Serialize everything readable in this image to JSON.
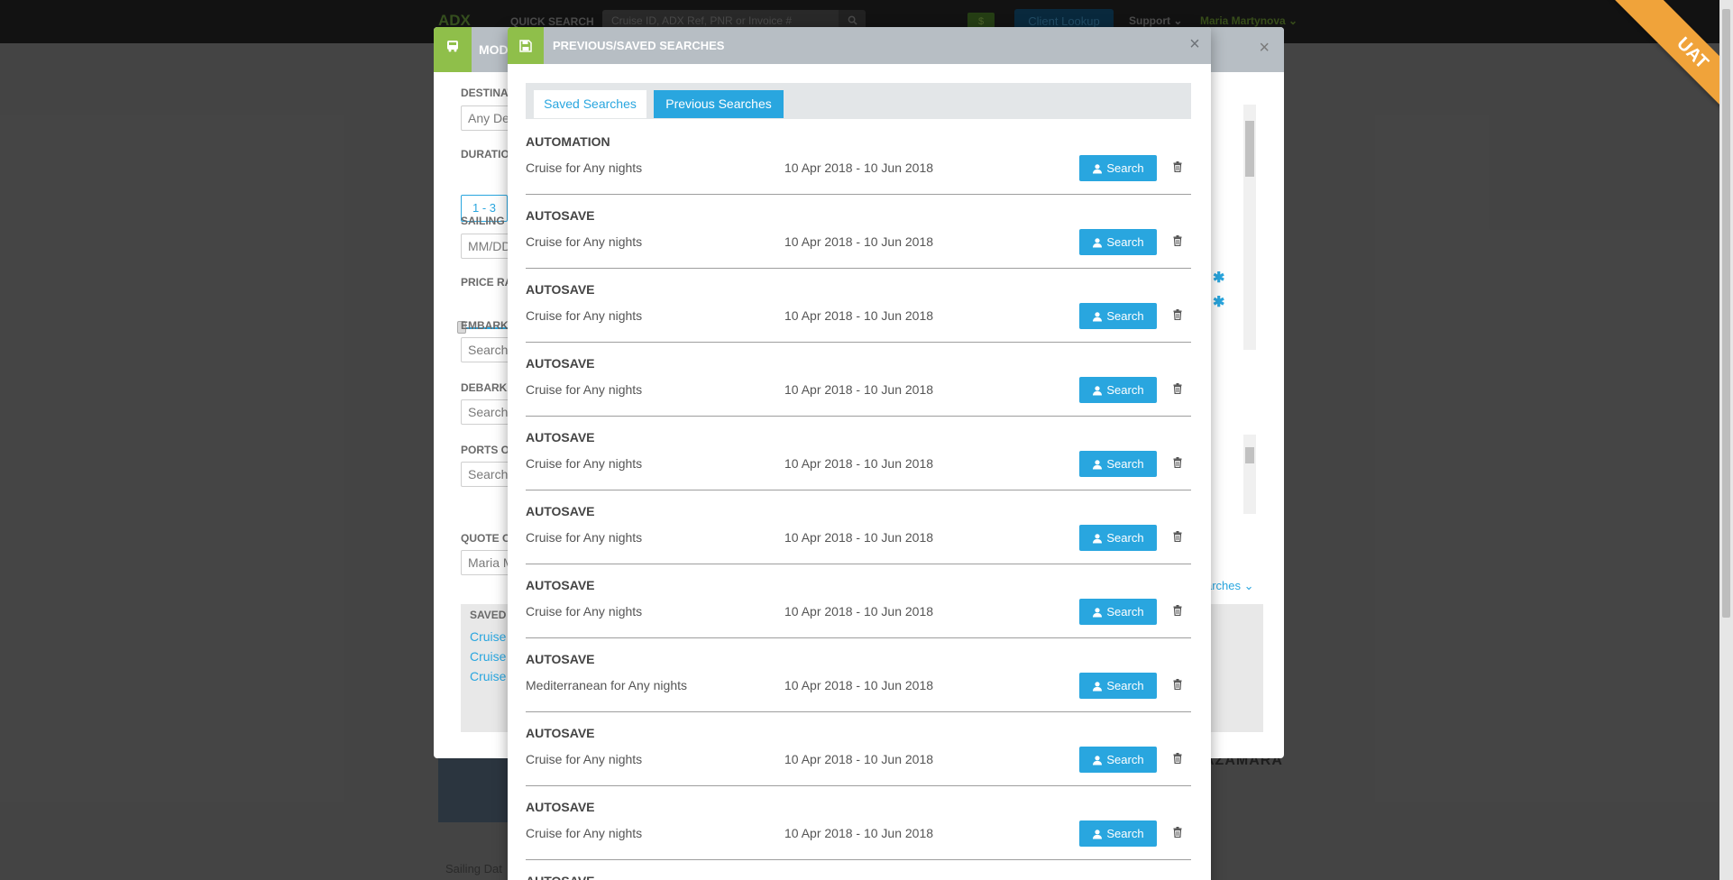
{
  "topbar": {
    "logo": "ADX",
    "quick_search_label": "QUICK SEARCH",
    "quick_search_placeholder": "Cruise ID, ADX Ref, PNR or Invoice #",
    "currency_badge": "$",
    "client_lookup_label": "Client Lookup",
    "support_label": "Support",
    "user_name": "Maria Martynova"
  },
  "ribbon": {
    "label": "UAT"
  },
  "back_modal": {
    "title": "MOD",
    "labels": {
      "destination": "DESTINAT",
      "duration": "DURATIO",
      "sailing": "SAILING",
      "price_range": "PRICE RA",
      "embark": "EMBARK",
      "debark": "DEBARKA",
      "ports": "PORTS O",
      "quote": "QUOTE O",
      "saved": "SAVED"
    },
    "destination_value": "Any De",
    "duration_value": "1 - 3",
    "sailing_placeholder": "MM/DD",
    "embark_placeholder": "Search",
    "debark_placeholder": "Search",
    "ports_placeholder": "Search",
    "quote_value": "Maria M",
    "saved_links": [
      "Cruise",
      "Cruise",
      "Cruise"
    ],
    "searches_link": "arches",
    "background_footer": "Sailing Dat",
    "background_brand": "AZAMARA"
  },
  "modal": {
    "title": "PREVIOUS/SAVED SEARCHES",
    "tabs": [
      {
        "label": "Saved Searches",
        "active": false
      },
      {
        "label": "Previous Searches",
        "active": true
      }
    ],
    "search_button_label": "Search",
    "rows": [
      {
        "title": "AUTOMATION",
        "description": "Cruise for Any nights",
        "dates": "10 Apr 2018 - 10 Jun 2018"
      },
      {
        "title": "AUTOSAVE",
        "description": "Cruise for Any nights",
        "dates": "10 Apr 2018 - 10 Jun 2018"
      },
      {
        "title": "AUTOSAVE",
        "description": "Cruise for Any nights",
        "dates": "10 Apr 2018 - 10 Jun 2018"
      },
      {
        "title": "AUTOSAVE",
        "description": "Cruise for Any nights",
        "dates": "10 Apr 2018 - 10 Jun 2018"
      },
      {
        "title": "AUTOSAVE",
        "description": "Cruise for Any nights",
        "dates": "10 Apr 2018 - 10 Jun 2018"
      },
      {
        "title": "AUTOSAVE",
        "description": "Cruise for Any nights",
        "dates": "10 Apr 2018 - 10 Jun 2018"
      },
      {
        "title": "AUTOSAVE",
        "description": "Cruise for Any nights",
        "dates": "10 Apr 2018 - 10 Jun 2018"
      },
      {
        "title": "AUTOSAVE",
        "description": "Mediterranean for Any nights",
        "dates": "10 Apr 2018 - 10 Jun 2018"
      },
      {
        "title": "AUTOSAVE",
        "description": "Cruise for Any nights",
        "dates": "10 Apr 2018 - 10 Jun 2018"
      },
      {
        "title": "AUTOSAVE",
        "description": "Cruise for Any nights",
        "dates": "10 Apr 2018 - 10 Jun 2018"
      }
    ],
    "partial_row_title": "AUTOSAVE"
  },
  "colors": {
    "accent": "#29a6df",
    "header_green": "#8fbf4a",
    "header_gray": "#b7bec4",
    "ribbon_orange": "#f0a33a"
  },
  "icons": {
    "header": "save-disk-icon",
    "row_button": "person-icon",
    "row_delete": "trash-icon",
    "back_header": "bus-icon"
  }
}
